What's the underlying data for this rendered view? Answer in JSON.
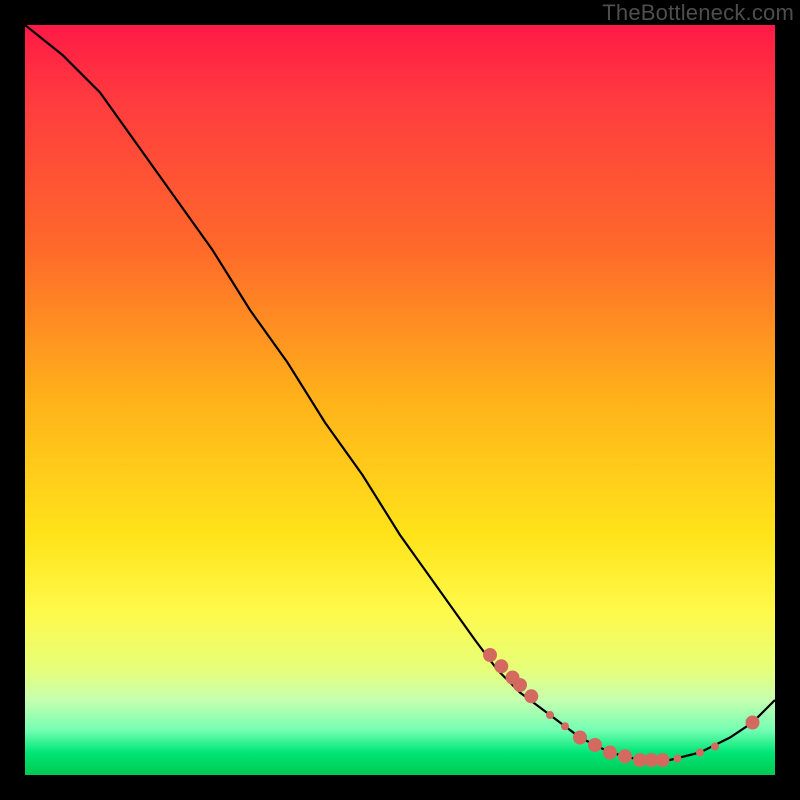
{
  "watermark": "TheBottleneck.com",
  "chart_data": {
    "type": "line",
    "title": "",
    "xlabel": "",
    "ylabel": "",
    "xlim": [
      0,
      100
    ],
    "ylim": [
      0,
      100
    ],
    "grid": false,
    "series": [
      {
        "name": "curve",
        "color": "#000000",
        "x": [
          0,
          5,
          10,
          15,
          20,
          25,
          30,
          35,
          40,
          45,
          50,
          55,
          60,
          63,
          66,
          70,
          74,
          78,
          82,
          86,
          90,
          94,
          97,
          100
        ],
        "y": [
          100,
          96,
          91,
          84,
          77,
          70,
          62,
          55,
          47,
          40,
          32,
          25,
          18,
          14,
          11,
          8,
          5,
          3,
          2,
          2,
          3,
          5,
          7,
          10
        ]
      }
    ],
    "marker_points": {
      "name": "highlighted",
      "color": "#d46a5f",
      "radius_primary": 7,
      "radius_secondary": 4,
      "x": [
        62,
        63.5,
        65,
        66,
        67.5,
        70,
        72,
        74,
        76,
        78,
        80,
        82,
        83.5,
        85,
        87,
        90,
        92,
        97
      ],
      "y": [
        16,
        14.5,
        13,
        12,
        10.5,
        8,
        6.5,
        5,
        4,
        3,
        2.5,
        2,
        2,
        2,
        2.2,
        3,
        3.8,
        7
      ]
    }
  }
}
